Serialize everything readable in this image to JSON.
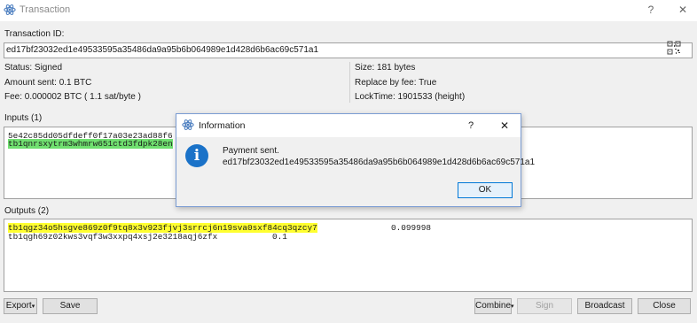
{
  "window": {
    "title": "Transaction",
    "help": "?",
    "close": "✕"
  },
  "txid": {
    "label": "Transaction ID:",
    "value": "ed17bf23032ed1e49533595a35486da9a95b6b064989e1d428d6b6ac69c571a1"
  },
  "details": {
    "status": "Status: Signed",
    "amount": "Amount sent: 0.1 BTC",
    "fee": "Fee: 0.000002 BTC  ( 1.1 sat/byte )",
    "size": "Size: 181 bytes",
    "rbf": "Replace by fee: True",
    "locktime": "LockTime: 1901533 (height)"
  },
  "inputs": {
    "label": "Inputs (1)",
    "line1": "5e42c85dd05dfdeff0f17a03e23ad88f6",
    "line2": "tb1qnrsxytrm3whmrw651ctd3fdpk28en"
  },
  "outputs": {
    "label": "Outputs (2)",
    "rows": [
      {
        "address": "tb1qgz34o5hsgve869z0f9tq8x3v923fjvj3srrcj6n19sva0sxf84cq3qzcy7",
        "amount": "0.099998"
      },
      {
        "address": "tb1qgh69z02kws3vqf3w3xxpq4xsj2e3218aqj6zfx",
        "amount": "0.1"
      }
    ]
  },
  "buttons": {
    "export": "Export",
    "save": "Save",
    "combine": "Combine",
    "sign": "Sign",
    "broadcast": "Broadcast",
    "close": "Close"
  },
  "dialog": {
    "title": "Information",
    "help": "?",
    "close": "✕",
    "message_line1": "Payment sent.",
    "message_line2": "ed17bf23032ed1e49533595a35486da9a95b6b064989e1d428d6b6ac69c571a1",
    "ok": "OK"
  }
}
